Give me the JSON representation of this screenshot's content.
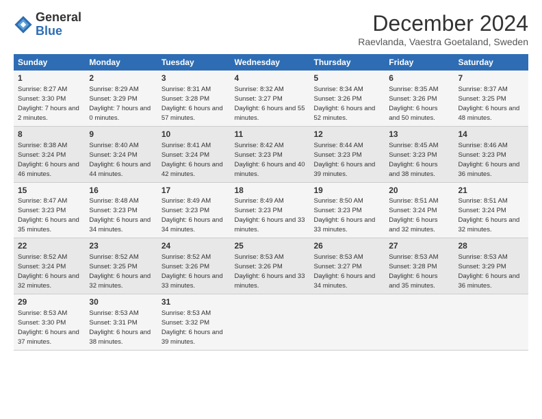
{
  "logo": {
    "general": "General",
    "blue": "Blue"
  },
  "title": "December 2024",
  "subtitle": "Raevlanda, Vaestra Goetaland, Sweden",
  "columns": [
    "Sunday",
    "Monday",
    "Tuesday",
    "Wednesday",
    "Thursday",
    "Friday",
    "Saturday"
  ],
  "weeks": [
    [
      {
        "day": "1",
        "sunrise": "8:27 AM",
        "sunset": "3:30 PM",
        "daylight": "7 hours and 2 minutes."
      },
      {
        "day": "2",
        "sunrise": "8:29 AM",
        "sunset": "3:29 PM",
        "daylight": "7 hours and 0 minutes."
      },
      {
        "day": "3",
        "sunrise": "8:31 AM",
        "sunset": "3:28 PM",
        "daylight": "6 hours and 57 minutes."
      },
      {
        "day": "4",
        "sunrise": "8:32 AM",
        "sunset": "3:27 PM",
        "daylight": "6 hours and 55 minutes."
      },
      {
        "day": "5",
        "sunrise": "8:34 AM",
        "sunset": "3:26 PM",
        "daylight": "6 hours and 52 minutes."
      },
      {
        "day": "6",
        "sunrise": "8:35 AM",
        "sunset": "3:26 PM",
        "daylight": "6 hours and 50 minutes."
      },
      {
        "day": "7",
        "sunrise": "8:37 AM",
        "sunset": "3:25 PM",
        "daylight": "6 hours and 48 minutes."
      }
    ],
    [
      {
        "day": "8",
        "sunrise": "8:38 AM",
        "sunset": "3:24 PM",
        "daylight": "6 hours and 46 minutes."
      },
      {
        "day": "9",
        "sunrise": "8:40 AM",
        "sunset": "3:24 PM",
        "daylight": "6 hours and 44 minutes."
      },
      {
        "day": "10",
        "sunrise": "8:41 AM",
        "sunset": "3:24 PM",
        "daylight": "6 hours and 42 minutes."
      },
      {
        "day": "11",
        "sunrise": "8:42 AM",
        "sunset": "3:23 PM",
        "daylight": "6 hours and 40 minutes."
      },
      {
        "day": "12",
        "sunrise": "8:44 AM",
        "sunset": "3:23 PM",
        "daylight": "6 hours and 39 minutes."
      },
      {
        "day": "13",
        "sunrise": "8:45 AM",
        "sunset": "3:23 PM",
        "daylight": "6 hours and 38 minutes."
      },
      {
        "day": "14",
        "sunrise": "8:46 AM",
        "sunset": "3:23 PM",
        "daylight": "6 hours and 36 minutes."
      }
    ],
    [
      {
        "day": "15",
        "sunrise": "8:47 AM",
        "sunset": "3:23 PM",
        "daylight": "6 hours and 35 minutes."
      },
      {
        "day": "16",
        "sunrise": "8:48 AM",
        "sunset": "3:23 PM",
        "daylight": "6 hours and 34 minutes."
      },
      {
        "day": "17",
        "sunrise": "8:49 AM",
        "sunset": "3:23 PM",
        "daylight": "6 hours and 34 minutes."
      },
      {
        "day": "18",
        "sunrise": "8:49 AM",
        "sunset": "3:23 PM",
        "daylight": "6 hours and 33 minutes."
      },
      {
        "day": "19",
        "sunrise": "8:50 AM",
        "sunset": "3:23 PM",
        "daylight": "6 hours and 33 minutes."
      },
      {
        "day": "20",
        "sunrise": "8:51 AM",
        "sunset": "3:24 PM",
        "daylight": "6 hours and 32 minutes."
      },
      {
        "day": "21",
        "sunrise": "8:51 AM",
        "sunset": "3:24 PM",
        "daylight": "6 hours and 32 minutes."
      }
    ],
    [
      {
        "day": "22",
        "sunrise": "8:52 AM",
        "sunset": "3:24 PM",
        "daylight": "6 hours and 32 minutes."
      },
      {
        "day": "23",
        "sunrise": "8:52 AM",
        "sunset": "3:25 PM",
        "daylight": "6 hours and 32 minutes."
      },
      {
        "day": "24",
        "sunrise": "8:52 AM",
        "sunset": "3:26 PM",
        "daylight": "6 hours and 33 minutes."
      },
      {
        "day": "25",
        "sunrise": "8:53 AM",
        "sunset": "3:26 PM",
        "daylight": "6 hours and 33 minutes."
      },
      {
        "day": "26",
        "sunrise": "8:53 AM",
        "sunset": "3:27 PM",
        "daylight": "6 hours and 34 minutes."
      },
      {
        "day": "27",
        "sunrise": "8:53 AM",
        "sunset": "3:28 PM",
        "daylight": "6 hours and 35 minutes."
      },
      {
        "day": "28",
        "sunrise": "8:53 AM",
        "sunset": "3:29 PM",
        "daylight": "6 hours and 36 minutes."
      }
    ],
    [
      {
        "day": "29",
        "sunrise": "8:53 AM",
        "sunset": "3:30 PM",
        "daylight": "6 hours and 37 minutes."
      },
      {
        "day": "30",
        "sunrise": "8:53 AM",
        "sunset": "3:31 PM",
        "daylight": "6 hours and 38 minutes."
      },
      {
        "day": "31",
        "sunrise": "8:53 AM",
        "sunset": "3:32 PM",
        "daylight": "6 hours and 39 minutes."
      },
      null,
      null,
      null,
      null
    ]
  ]
}
